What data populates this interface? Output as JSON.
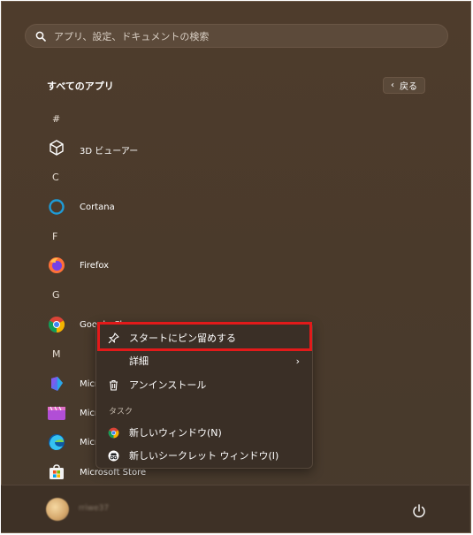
{
  "search": {
    "placeholder": "アプリ、設定、ドキュメントの検索"
  },
  "section": {
    "title": "すべてのアプリ",
    "back_label": "戻る"
  },
  "letters": [
    "#",
    "C",
    "F",
    "G",
    "M"
  ],
  "apps": [
    {
      "name": "3D ビューアー",
      "icon": "cube-icon"
    },
    {
      "name": "Cortana",
      "icon": "cortana-icon"
    },
    {
      "name": "Firefox",
      "icon": "firefox-icon"
    },
    {
      "name": "Google Chrome",
      "icon": "chrome-icon"
    },
    {
      "name": "Micr",
      "icon": "clipchamp-icon"
    },
    {
      "name": "Micr",
      "icon": "video-editor-icon"
    },
    {
      "name": "Micr",
      "icon": "edge-icon"
    },
    {
      "name": "Microsoft Store",
      "icon": "store-icon"
    }
  ],
  "user": {
    "name": "rriwe37"
  },
  "context_menu": {
    "pin": "スタートにピン留めする",
    "details": "詳細",
    "uninstall": "アンインストール",
    "task_header": "タスク",
    "new_window": "新しいウィンドウ(N)",
    "new_incognito": "新しいシークレット ウィンドウ(I)"
  },
  "colors": {
    "highlight": "#e21a1a",
    "accent": "#1e9bd7"
  }
}
